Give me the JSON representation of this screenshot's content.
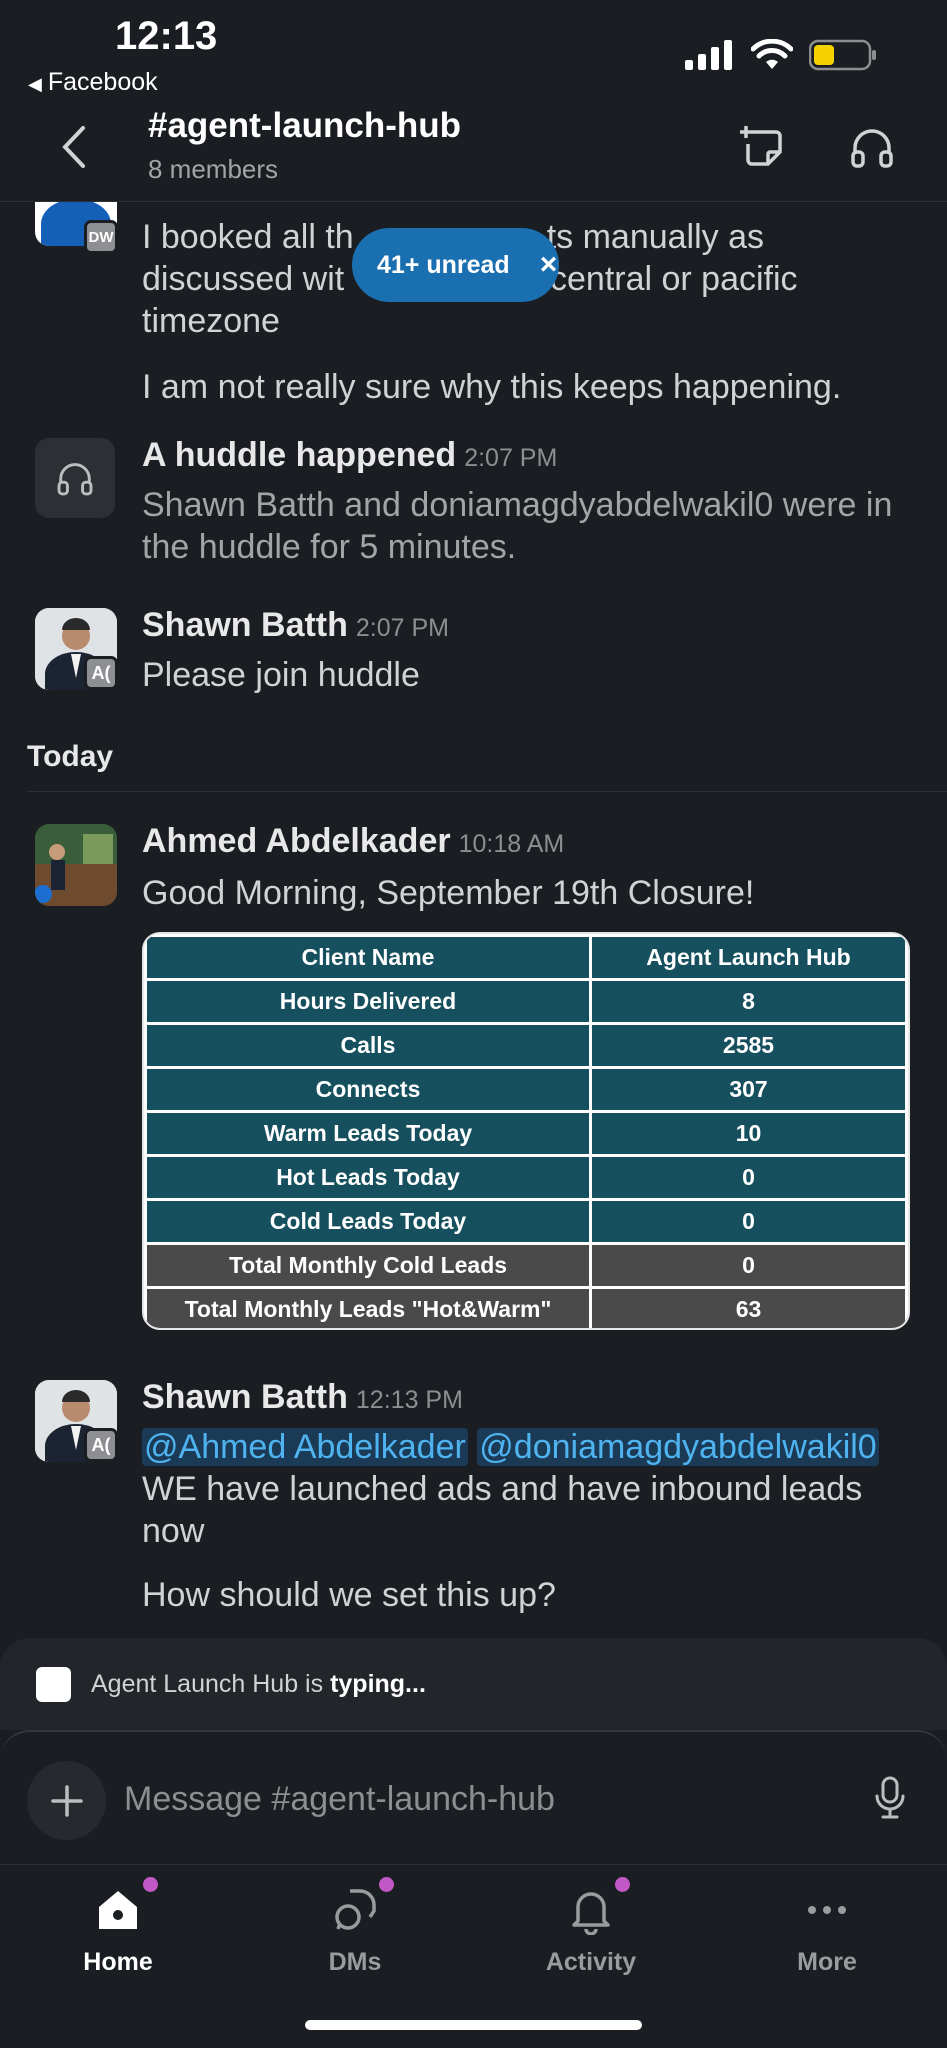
{
  "status": {
    "time": "12:13",
    "back_app": "Facebook"
  },
  "header": {
    "channel": "#agent-launch-hub",
    "members": "8 members"
  },
  "unread": {
    "label": "41+ unread",
    "close": "×"
  },
  "messages": {
    "m1": {
      "badge": "DW",
      "line1": "I booked all th",
      "line1b": "ts manually as",
      "line2": "discussed wit",
      "line2b": "n, central or pacific",
      "line3": "timezone",
      "para2": "I am not really sure why this keeps happening."
    },
    "huddle": {
      "title": "A huddle happened",
      "time": "2:07 PM",
      "text": "Shawn Batth and doniamagdyabdelwakil0 were in the huddle for 5 minutes."
    },
    "m2": {
      "sender": "Shawn Batth",
      "time": "2:07 PM",
      "badge": "A(",
      "text": "Please join huddle"
    },
    "today": "Today",
    "m3": {
      "sender": "Ahmed Abdelkader",
      "time": "10:18 AM",
      "text": "Good Morning, September 19th Closure!"
    },
    "m4": {
      "sender": "Shawn Batth",
      "time": "12:13 PM",
      "badge": "A(",
      "mention1": "@Ahmed Abdelkader",
      "mention2": "@doniamagdyabdelwakil0",
      "text": "WE have launched ads and have inbound leads now",
      "para2": "How should we set this up?"
    }
  },
  "report_table": {
    "rows": [
      {
        "label": "Client Name",
        "value": "Agent Launch Hub",
        "style": "teal"
      },
      {
        "label": "Hours Delivered",
        "value": "8",
        "style": "teal"
      },
      {
        "label": "Calls",
        "value": "2585",
        "style": "teal"
      },
      {
        "label": "Connects",
        "value": "307",
        "style": "teal"
      },
      {
        "label": "Warm Leads Today",
        "value": "10",
        "style": "teal"
      },
      {
        "label": "Hot Leads Today",
        "value": "0",
        "style": "teal"
      },
      {
        "label": "Cold Leads Today",
        "value": "0",
        "style": "teal"
      },
      {
        "label": "Total Monthly Cold Leads",
        "value": "0",
        "style": "gray"
      },
      {
        "label": "Total Monthly Leads \"Hot&Warm\"",
        "value": "63",
        "style": "gray"
      }
    ]
  },
  "typing": {
    "name": "Agent Launch Hub",
    "middle": " is ",
    "bold": "typing..."
  },
  "composer": {
    "placeholder": "Message #agent-launch-hub"
  },
  "tabs": {
    "home": "Home",
    "dms": "DMs",
    "activity": "Activity",
    "more": "More"
  },
  "colors": {
    "background": "#1a1d21",
    "accent": "#1a6fb0",
    "mention": "#4fb3f0",
    "teal": "#16505f",
    "notif_dot": "#c257c6"
  },
  "icons": [
    "back-triangle-icon",
    "signal-icon",
    "wifi-icon",
    "battery-icon",
    "chevron-left-icon",
    "new-canvas-icon",
    "headphones-icon",
    "close-icon",
    "plus-icon",
    "microphone-icon",
    "home-icon",
    "dms-icon",
    "bell-icon",
    "more-icon"
  ]
}
